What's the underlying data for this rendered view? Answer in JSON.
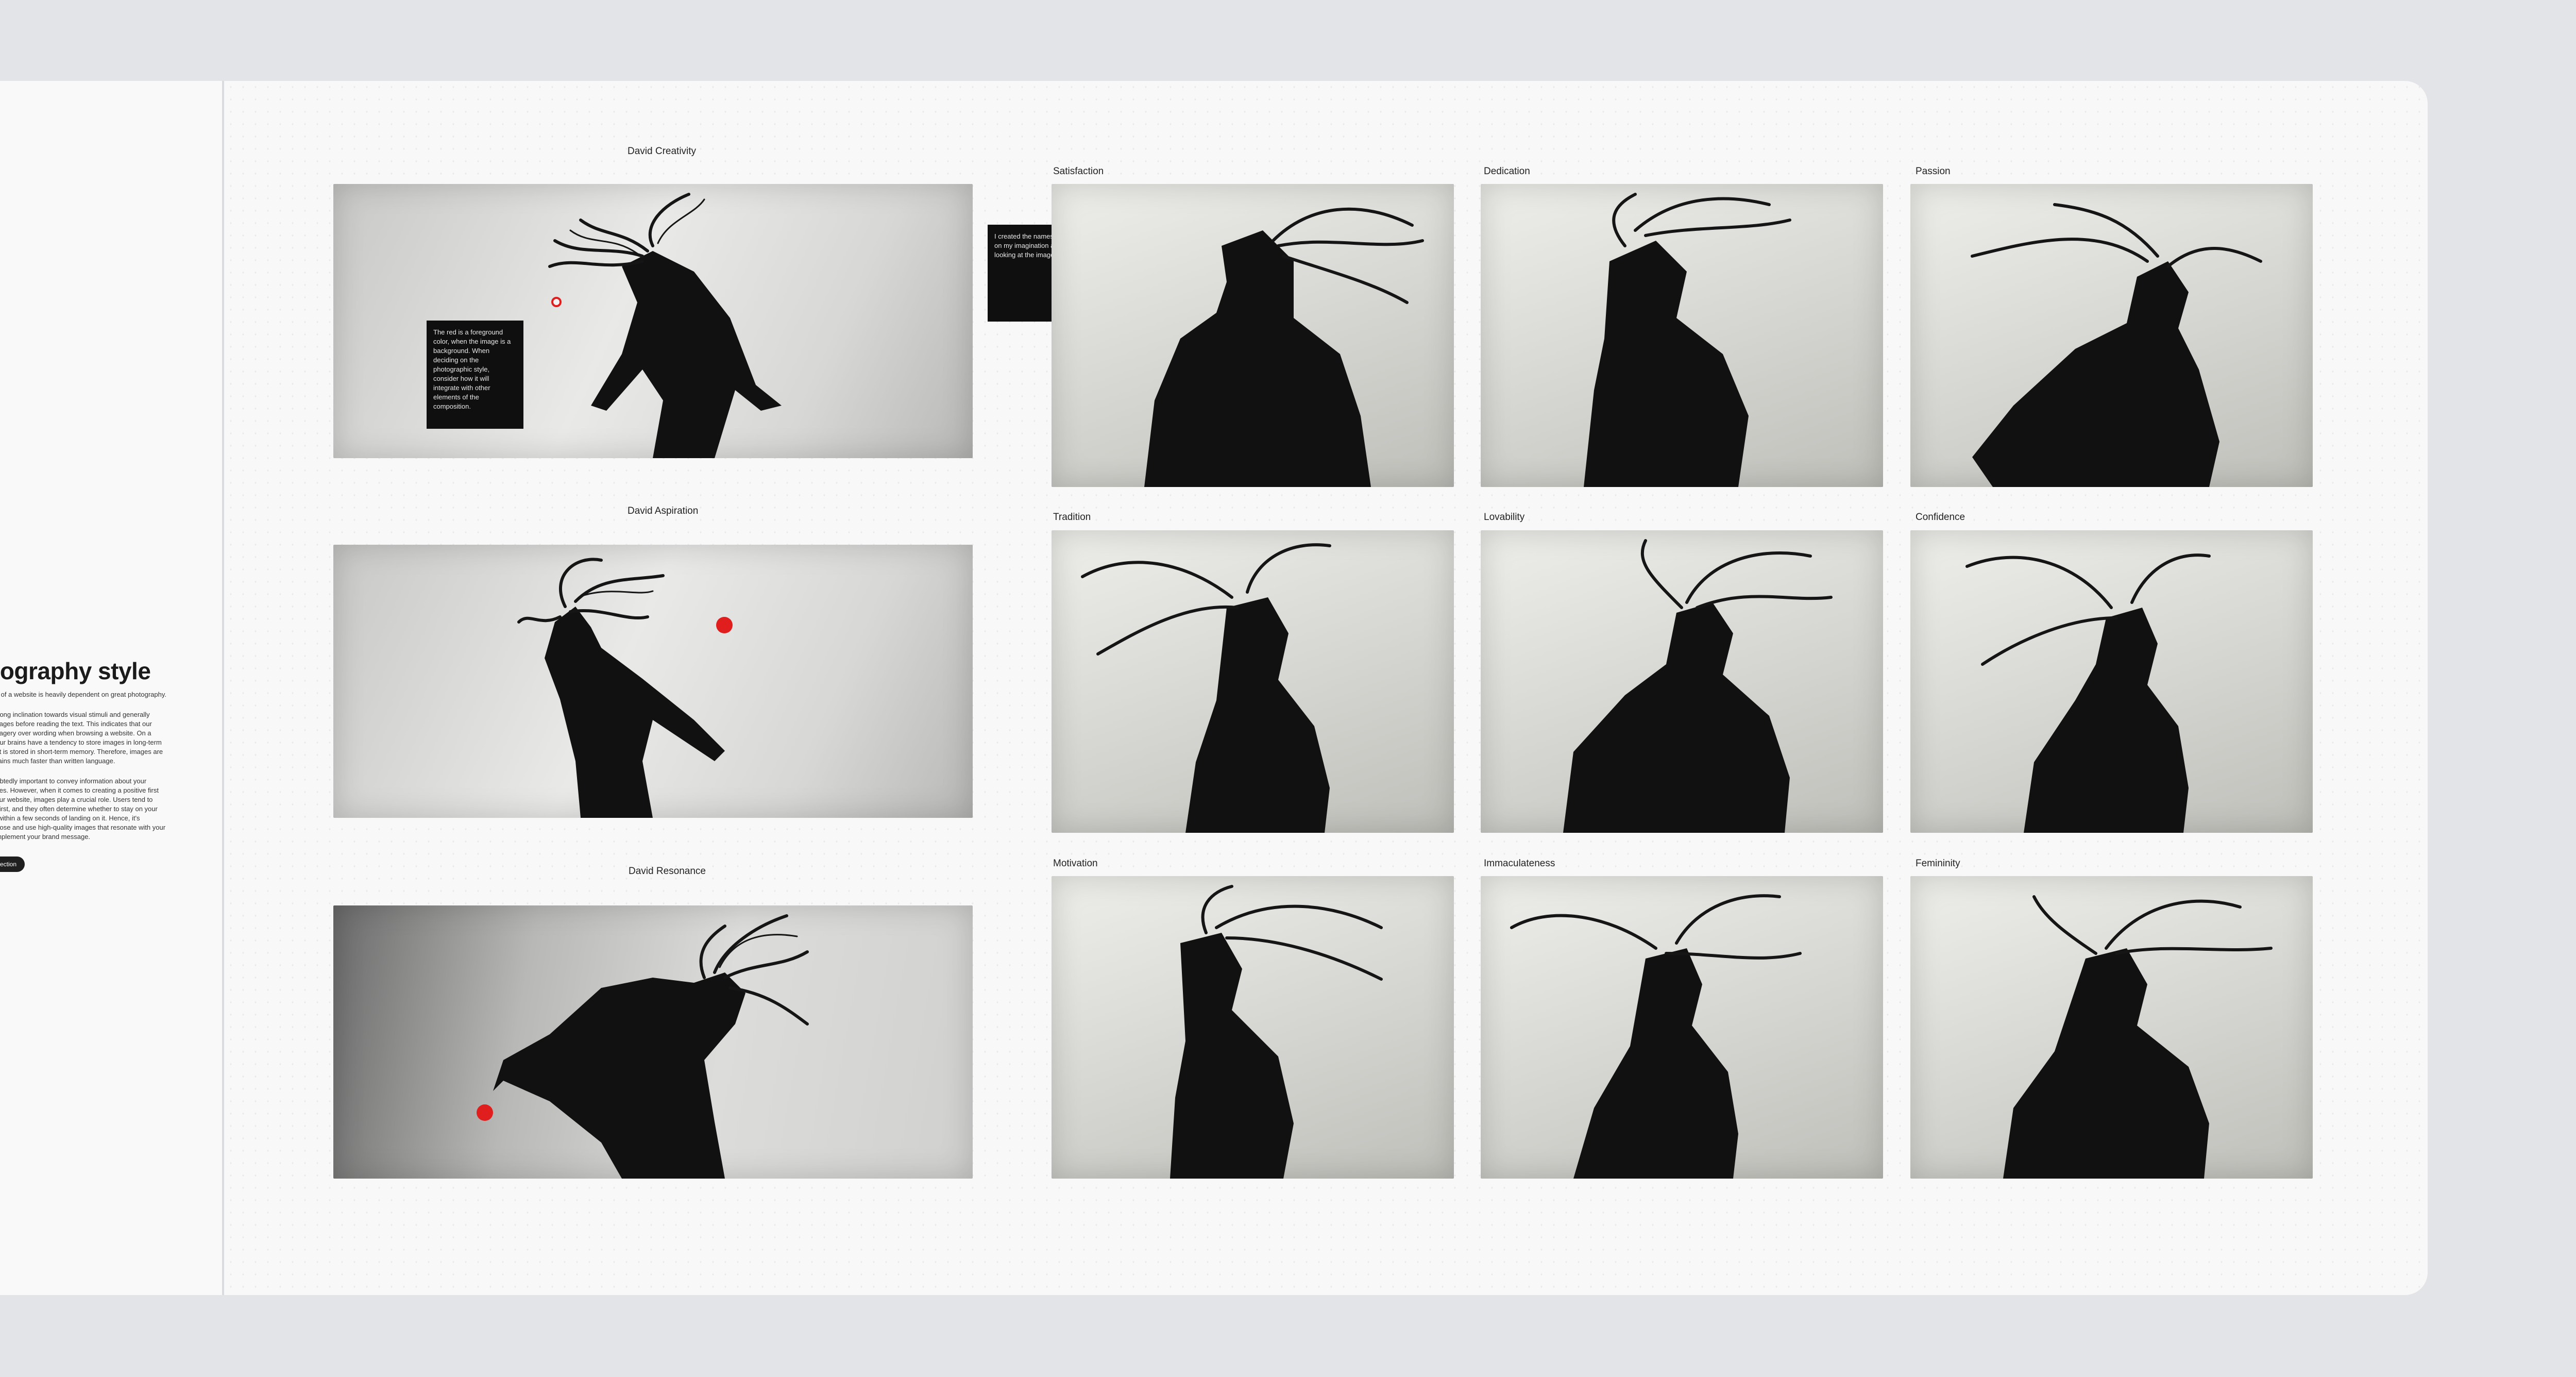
{
  "left_panel": {
    "heading": "tography style",
    "intro": "ity of a website is heavily dependent on great photography.",
    "paragraph_1": "strong inclination towards visual stimuli and generally\nimages before reading the text. This indicates that our\nimagery over wording when browsing a website. On a\n, our brains have a tendency to store images in long-term\next is stored in short-term memory. Therefore, images are\nbrains much faster than written language.",
    "paragraph_2": "oubtedly important to convey information about your\nrices. However, when it comes to creating a positive first\nyour website, images play a crucial role. Users tend to\ns first, and they often determine whether to stay on your\ne within a few seconds of landing on it. Hence, it's\nhoose and use high-quality images that resonate with your\nomplement your brand message.",
    "button_label": "ection"
  },
  "david_images": [
    {
      "title": "David Creativity",
      "accent_color": "#e01e1e"
    },
    {
      "title": "David Aspiration",
      "accent_color": "#e01e1e"
    },
    {
      "title": "David Resonance",
      "accent_color": "#e01e1e"
    }
  ],
  "notes": {
    "red_note": "The red is a foreground\ncolor, when the image is a\nbackground. When\ndeciding on the\nphotographic style,\nconsider how it will\nintegrate with other\nelements of the\ncomposition.",
    "names_note": "I created the names based\non my imagination after\nlooking at the images."
  },
  "grid_images": [
    {
      "title": "Satisfaction"
    },
    {
      "title": "Dedication"
    },
    {
      "title": "Passion"
    },
    {
      "title": "Tradition"
    },
    {
      "title": "Lovability"
    },
    {
      "title": "Confidence"
    },
    {
      "title": "Motivation"
    },
    {
      "title": "Immaculateness"
    },
    {
      "title": "Femininity"
    }
  ]
}
